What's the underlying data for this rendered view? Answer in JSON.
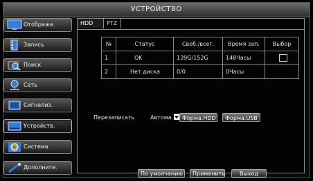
{
  "window": {
    "title": "УСТРОЙСТВО"
  },
  "sidebar": {
    "items": [
      {
        "label": "Отображе.",
        "icon": "monitor-icon"
      },
      {
        "label": "Запись",
        "icon": "film-icon"
      },
      {
        "label": "Поиск",
        "icon": "magnifier-icon"
      },
      {
        "label": "Сеть",
        "icon": "network-icon"
      },
      {
        "label": "Сигнализ.",
        "icon": "alarm-icon"
      },
      {
        "label": "Устройств.",
        "icon": "device-icon",
        "active": true
      },
      {
        "label": "Система",
        "icon": "gear-icon"
      },
      {
        "label": "Дополните.",
        "icon": "tools-icon"
      }
    ]
  },
  "tabs": [
    {
      "label": "HDD",
      "active": true
    },
    {
      "label": "PTZ",
      "active": false
    }
  ],
  "hdd_table": {
    "headers": [
      "№",
      "Статус",
      "Своб./всег.",
      "Время зап.",
      "Выбор"
    ],
    "rows": [
      {
        "no": "1",
        "status": "OK",
        "free_total": "139G/152G",
        "rec_time": "148Часы",
        "select": "checkbox"
      },
      {
        "no": "2",
        "status": "Нет диска",
        "free_total": "0/0",
        "rec_time": "0Часы",
        "select": ""
      }
    ]
  },
  "overwrite": {
    "label": "Перезаписать",
    "value": "Автома."
  },
  "buttons": {
    "format_hdd": "Форма.HDD",
    "format_usb": "Форма.USB",
    "default": "По умолчанию",
    "apply": "Применить",
    "exit": "Выход"
  },
  "colors": {
    "background": "#000000",
    "border": "#8a8a8a",
    "text": "#e6e6e6",
    "icon_blue": "#2f7fe0"
  }
}
